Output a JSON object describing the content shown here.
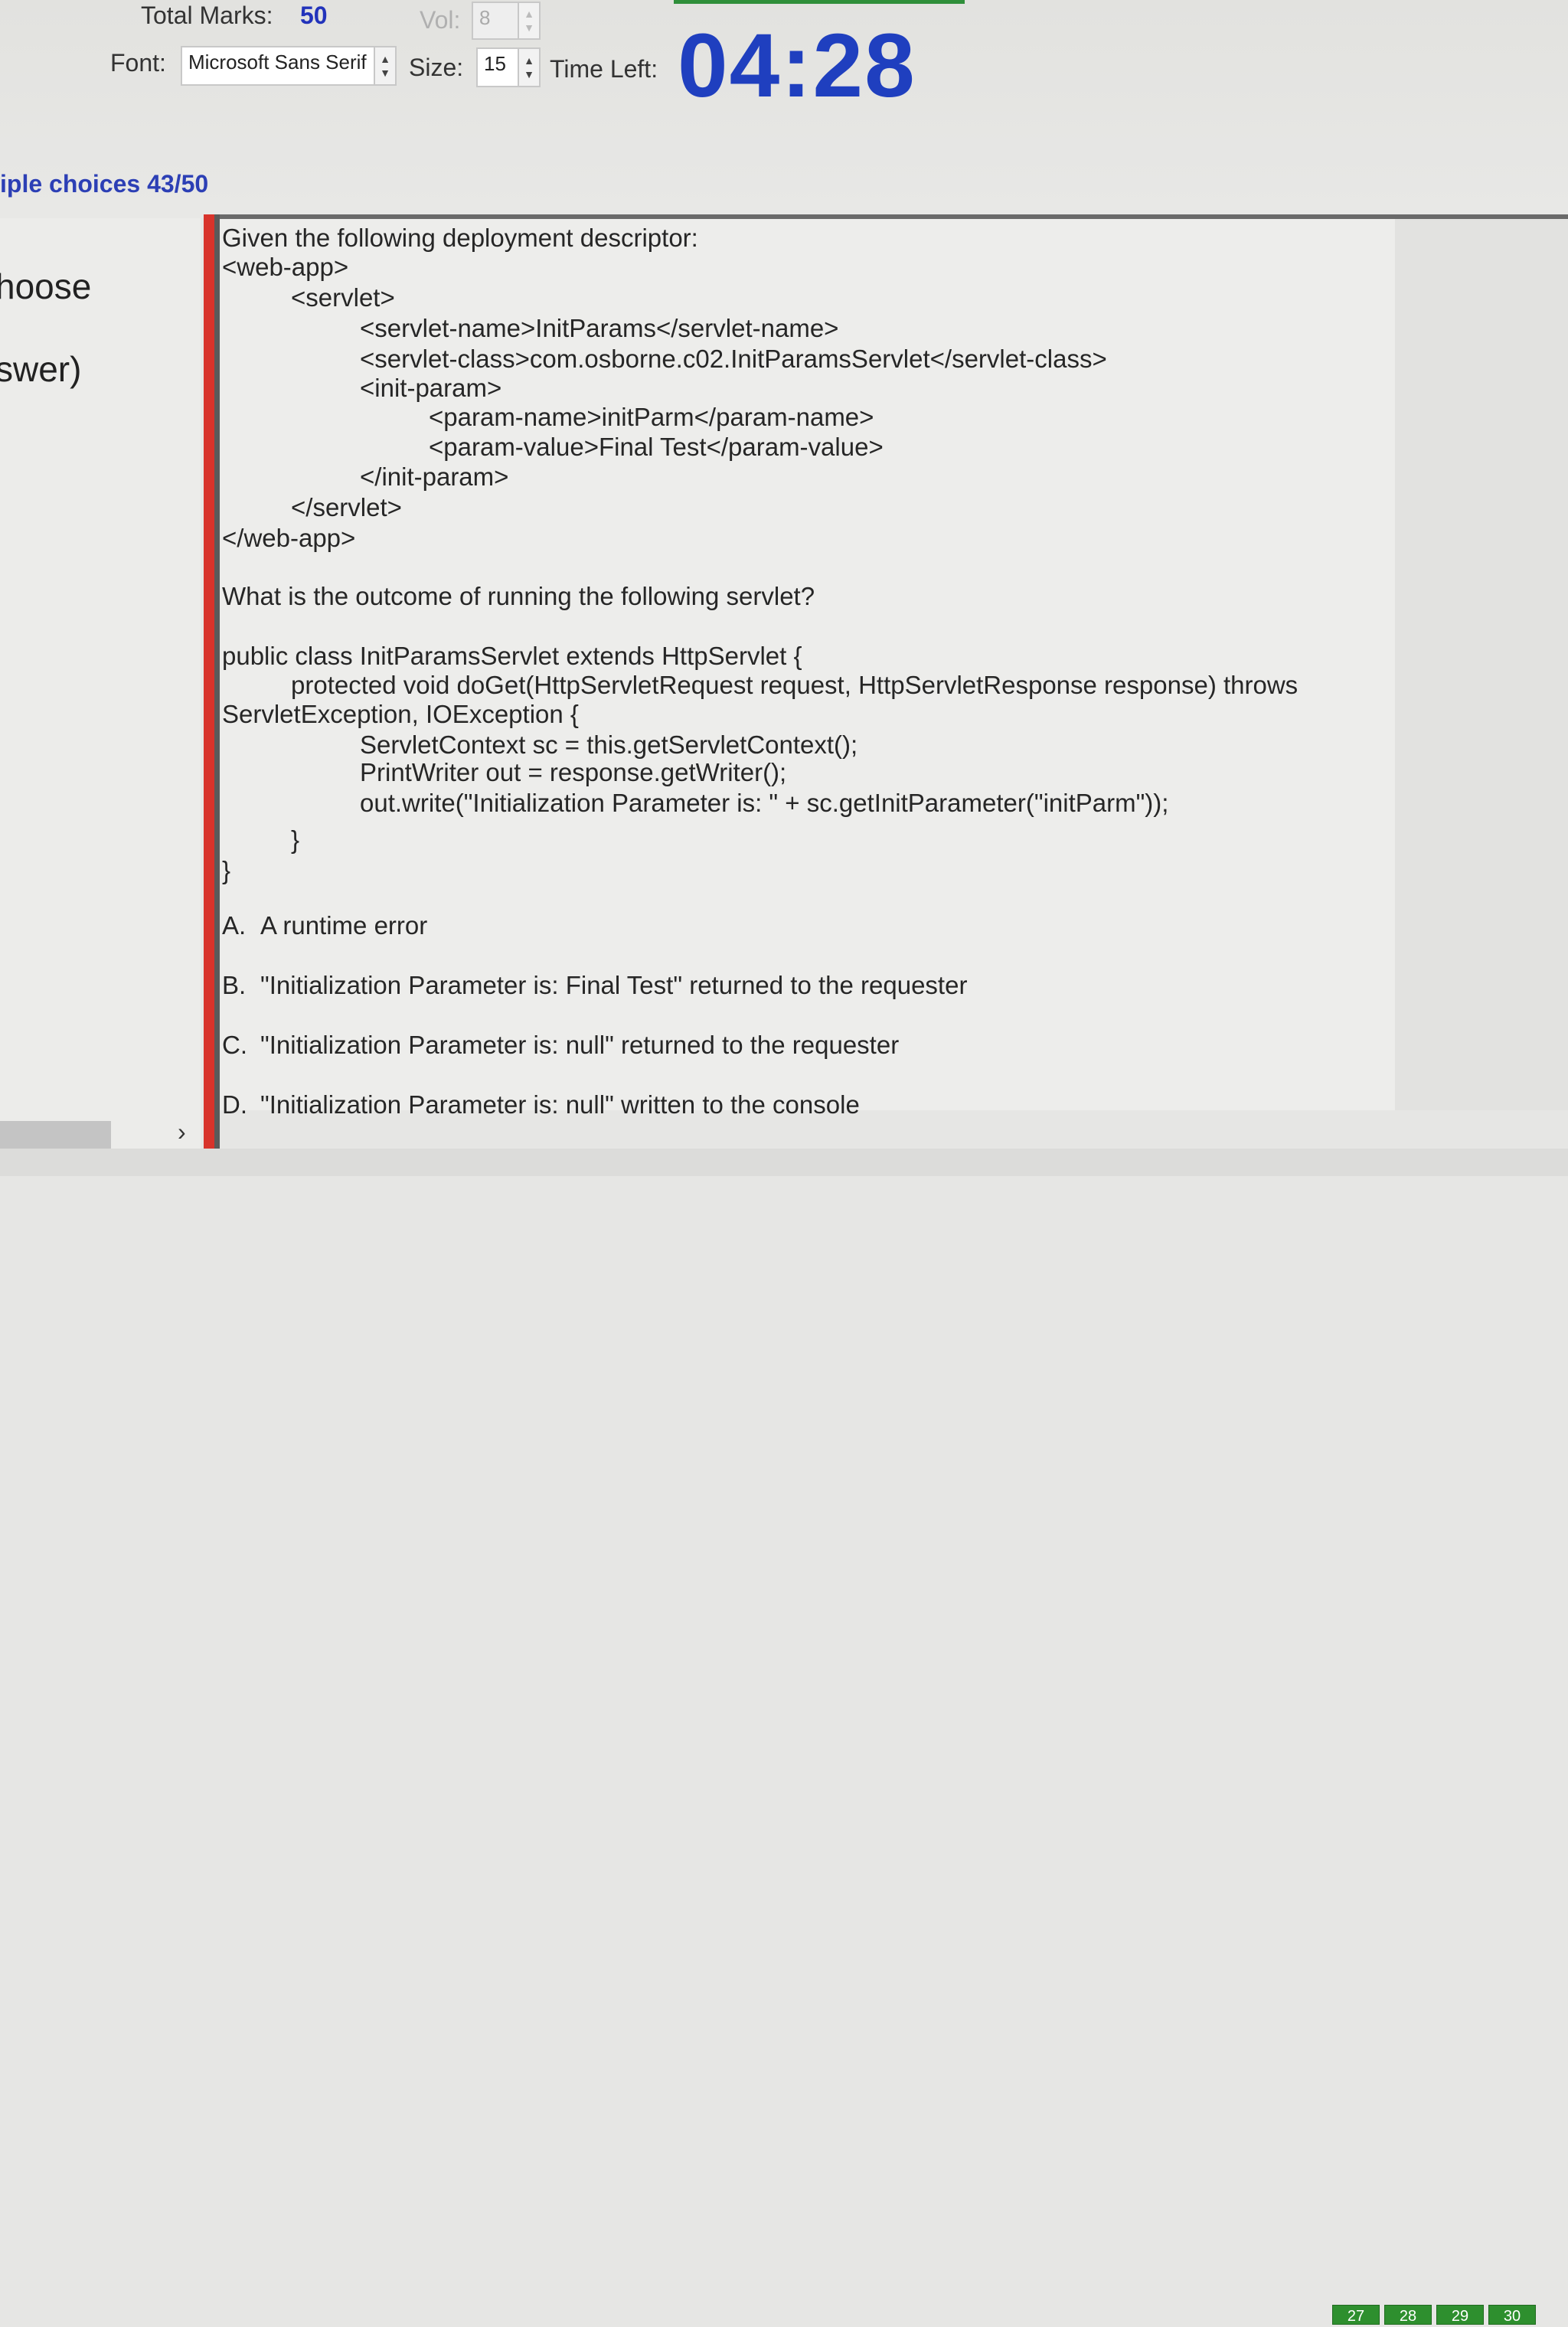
{
  "header": {
    "total_marks_label": "Total Marks:",
    "total_marks_value": "50",
    "vol_label": "Vol:",
    "vol_value": "8",
    "font_label": "Font:",
    "font_value": "Microsoft Sans Serif",
    "size_label": "Size:",
    "size_value": "15",
    "time_left_label": "Time Left:",
    "timer": "04:28"
  },
  "progress": {
    "label": "iple choices 43/50"
  },
  "left_panel": {
    "line1": "hoose",
    "line2": "swer)"
  },
  "question": {
    "lines": [
      "Given the following deployment descriptor:",
      "<web-app>",
      "<servlet>",
      "<servlet-name>InitParams</servlet-name>",
      "<servlet-class>com.osborne.c02.InitParamsServlet</servlet-class>",
      "<init-param>",
      "<param-name>initParm</param-name>",
      "<param-value>Final Test</param-value>",
      "</init-param>",
      "</servlet>",
      "</web-app>",
      "What is the outcome of running the following servlet?",
      "public class InitParamsServlet extends HttpServlet {",
      "protected void doGet(HttpServletRequest request, HttpServletResponse response) throws",
      "ServletException, IOException {",
      "ServletContext sc = this.getServletContext();",
      "PrintWriter out = response.getWriter();",
      "out.write(\"Initialization Parameter is: \" + sc.getInitParameter(\"initParm\"));",
      "}",
      "}"
    ]
  },
  "options": [
    {
      "letter": "A.",
      "text": "A runtime error"
    },
    {
      "letter": "B.",
      "text": "\"Initialization Parameter is: Final Test\" returned to the requester"
    },
    {
      "letter": "C.",
      "text": "\"Initialization Parameter is: null\" returned to the requester"
    },
    {
      "letter": "D.",
      "text": "\"Initialization Parameter is: null\" written to the console"
    }
  ],
  "nav": {
    "buttons": [
      "27",
      "28",
      "29",
      "30"
    ],
    "arrow": "›"
  },
  "colors": {
    "timer": "#1f3fbf",
    "accent_red": "#d8332b",
    "nav_green": "#2e8f2e"
  }
}
